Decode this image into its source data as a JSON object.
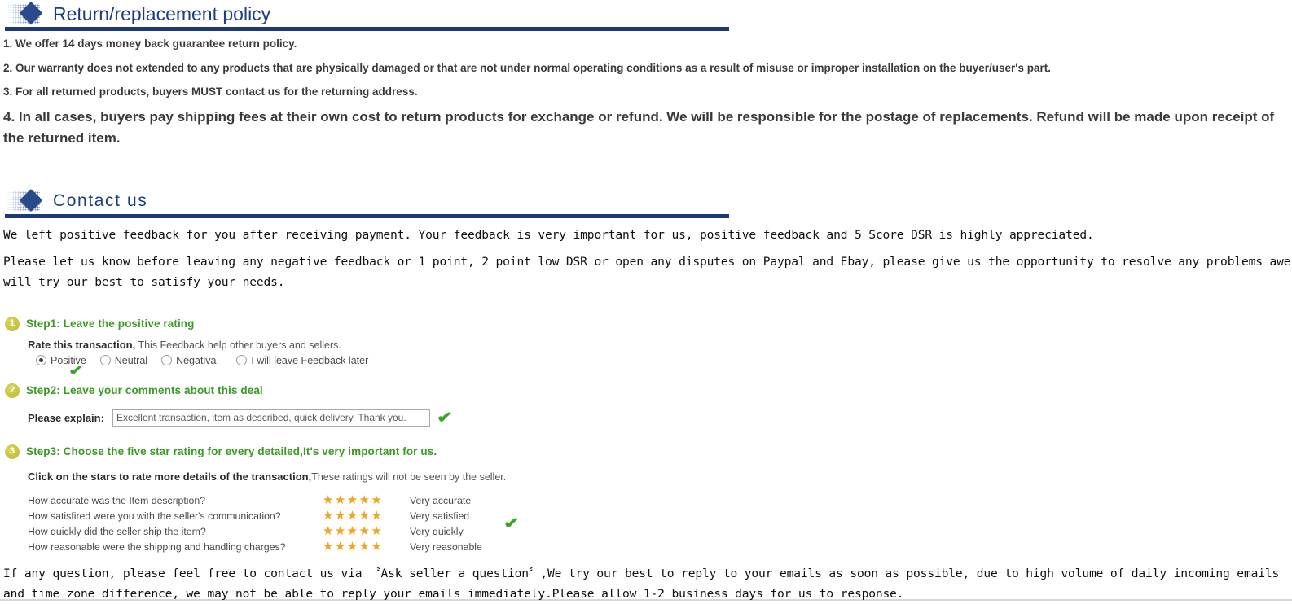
{
  "sections": {
    "return_policy": {
      "title": "Return/replacement policy",
      "icon": "diamond-icon",
      "items": [
        "1. We offer 14 days money back guarantee return policy.",
        "2. Our warranty does not extended to any products that are physically damaged or that are not under normal operating conditions as a result of misuse or improper installation on the buyer/user's part.",
        "3. For all returned products, buyers MUST contact us for the returning address.",
        "4. In all cases, buyers pay shipping fees at their own cost to return products for exchange or refund. We will be responsible for the postage of replacements. Refund will be made upon receipt of the returned item."
      ]
    },
    "contact_us": {
      "title": "Contact us",
      "icon": "diamond-icon",
      "paragraphs": [
        "We left positive feedback for you after receiving payment. Your feedback is very important for us, positive feedback and 5 Score DSR is highly appreciated.",
        "Please let us know before leaving any negative feedback or 1 point, 2 point low DSR or open any disputes on Paypal and Ebay, please give us the opportunity to resolve any problems awe will try our best to satisfy your needs."
      ],
      "footer_paragraph": "If any question, please feel free to contact us via 〝Ask seller a question〞,We try our best to reply to your emails as soon as possible, due to high volume of daily incoming emails and time zone difference, we may not be able to reply your emails immediately.Please allow 1-2 business days for us to response."
    }
  },
  "steps": {
    "step1": {
      "badge": "1",
      "title": "Step1: Leave the positive rating",
      "rate_label": "Rate this transaction,",
      "rate_hint": "This Feedback help other buyers and sellers.",
      "options": [
        {
          "label": "Positive",
          "checked": true
        },
        {
          "label": "Neutral",
          "checked": false
        },
        {
          "label": "Negativa",
          "checked": false
        },
        {
          "label": "I will leave Feedback later",
          "checked": false
        }
      ],
      "check_mark": "✔"
    },
    "step2": {
      "badge": "2",
      "title": "Step2: Leave your comments about this deal",
      "explain_label": "Please explain:",
      "explain_value": "Excellent transaction, item as described, quick delivery. Thank you.",
      "check_mark": "✔"
    },
    "step3": {
      "badge": "3",
      "title": "Step3: Choose the five star rating for every detailed,It's very important for us.",
      "click_label": "Click on the stars to rate more details of the transaction,",
      "click_hint": "These ratings will not be seen by the seller.",
      "check_mark": "✔",
      "rows": [
        {
          "question": "How accurate was the Item description?",
          "stars": "★★★★★",
          "rating_label": "Very accurate"
        },
        {
          "question": "How satisfired were you with the seller's communication?",
          "stars": "★★★★★",
          "rating_label": "Very satisfied"
        },
        {
          "question": "How quickly did the seller ship the item?",
          "stars": "★★★★★",
          "rating_label": "Very quickly"
        },
        {
          "question": "How reasonable were the shipping and handling charges?",
          "stars": "★★★★★",
          "rating_label": "Very reasonable"
        }
      ]
    }
  },
  "colors": {
    "header_blue": "#1c3d85",
    "rule_blue": "#1c3a77",
    "step_green": "#3a9a24",
    "badge_yellow": "#c2c23c",
    "star_orange": "#f5a31e",
    "check_green": "#3aa526"
  }
}
